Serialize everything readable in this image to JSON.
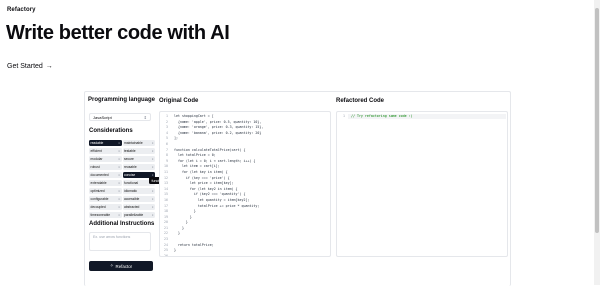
{
  "header": {
    "brand": "Refactory",
    "hero": "Write better code with AI",
    "cta_label": "Get Started",
    "cta_icon": "arrow-right-icon"
  },
  "sidebar": {
    "language_title": "Programming language",
    "language_value": "JavaScript",
    "considerations_title": "Considerations",
    "considerations": [
      {
        "label": "readable",
        "selected": true
      },
      {
        "label": "maintainable",
        "selected": false
      },
      {
        "label": "efficient",
        "selected": false
      },
      {
        "label": "testable",
        "selected": false
      },
      {
        "label": "modular",
        "selected": false
      },
      {
        "label": "secure",
        "selected": false
      },
      {
        "label": "robust",
        "selected": false
      },
      {
        "label": "reusable",
        "selected": false
      },
      {
        "label": "documented",
        "selected": false
      },
      {
        "label": "concise",
        "selected": true
      },
      {
        "label": "extendable",
        "selected": false
      },
      {
        "label": "functional",
        "selected": false
      },
      {
        "label": "optimized",
        "selected": false
      },
      {
        "label": "idiomatic",
        "selected": false
      },
      {
        "label": "configurable",
        "selected": false
      },
      {
        "label": "accessible",
        "selected": false
      },
      {
        "label": "decoupled",
        "selected": false
      },
      {
        "label": "abstracted",
        "selected": false
      },
      {
        "label": "timezoneable",
        "selected": false
      },
      {
        "label": "parallelizable",
        "selected": false
      }
    ],
    "tooltip": "functional",
    "instructions_title": "Additional Instructions",
    "instructions_placeholder": "Ex. use arrow functions",
    "refactor_label": "Refactor"
  },
  "original": {
    "title": "Original Code",
    "line_numbers": "1\n2\n3\n4\n5\n6\n7\n8\n9\n10\n11\n12\n13\n14\n15\n16\n17\n18\n19\n20\n21\n22\n23\n24\n25\n26\n27",
    "code": "let shoppingCart = [\n  {name: 'apple', price: 0.5, quantity: 10},\n  {name: 'orange', price: 0.3, quantity: 15},\n  {name: 'banana', price: 0.2, quantity: 20}\n];\n\nfunction calculateTotalPrice(cart) {\n  let totalPrice = 0;\n  for (let i = 0; i < cart.length; i++) {\n    let item = cart[i];\n    for (let key in item) {\n      if (key === 'price') {\n        let price = item[key];\n        for (let key2 in item) {\n          if (key2 === 'quantity') {\n            let quantity = item[key2];\n            totalPrice += price * quantity;\n          }\n        }\n      }\n    }\n  }\n\n  return totalPrice;\n}\n\nconsole.log(calculateTotalPrice(shoppingCart));"
  },
  "refactored": {
    "title": "Refactored Code",
    "line_numbers": "1",
    "code": "// Try refactoring some code :)"
  }
}
